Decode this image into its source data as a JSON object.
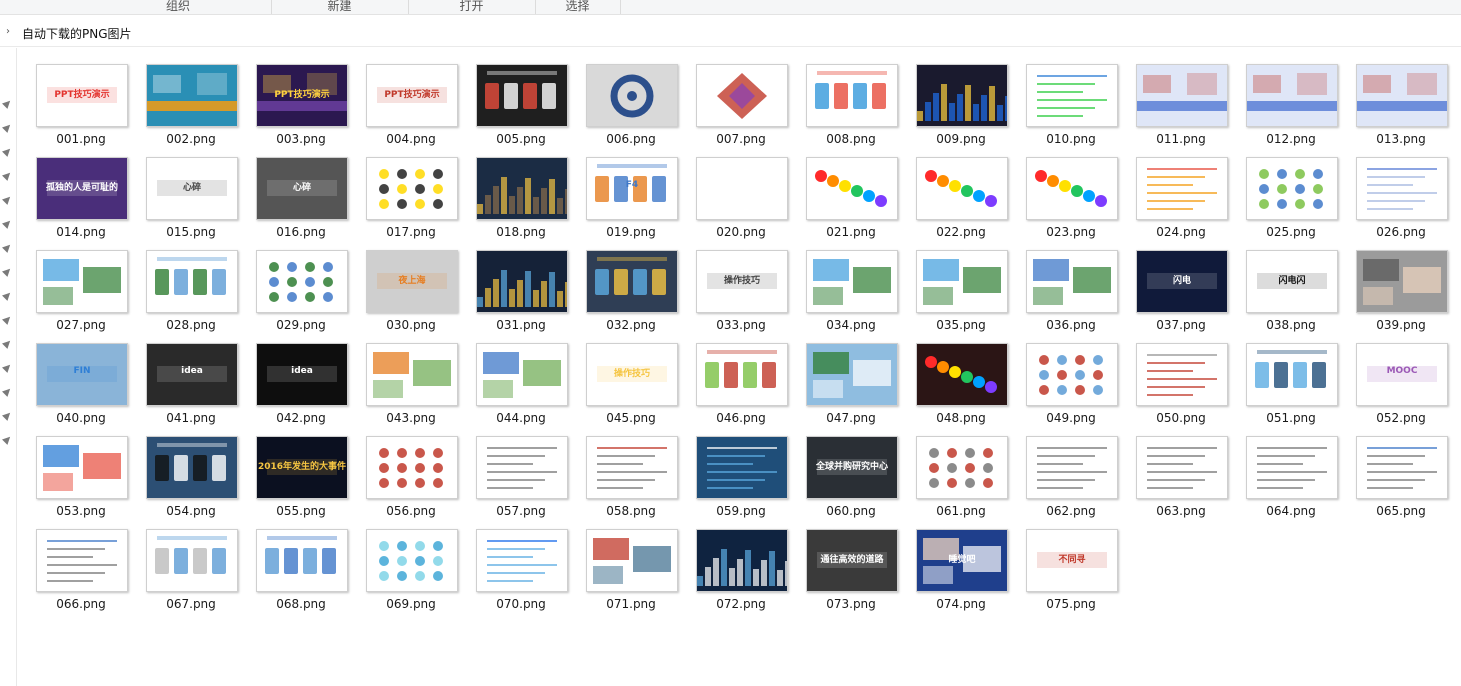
{
  "toolbar": {
    "groups": [
      "组织",
      "新建",
      "打开",
      "选择"
    ]
  },
  "address": {
    "path": "自动下载的PNG图片"
  },
  "files": [
    {
      "name": "001.png",
      "bg": "#ffffff",
      "fg": "#e3342f",
      "accent": "#2f7fd6",
      "motif": "text",
      "text": "PPT技巧演示"
    },
    {
      "name": "002.png",
      "bg": "#2a8fb5",
      "fg": "#ffffff",
      "accent": "#f39c12",
      "motif": "banner",
      "text": ""
    },
    {
      "name": "003.png",
      "bg": "#2b1850",
      "fg": "#ffd23f",
      "accent": "#6b3fa0",
      "motif": "banner",
      "text": "PPT技巧演示"
    },
    {
      "name": "004.png",
      "bg": "#ffffff",
      "fg": "#c0392b",
      "accent": "#2ecc40",
      "motif": "text",
      "text": "PPT技巧演示"
    },
    {
      "name": "005.png",
      "bg": "#1f1f1f",
      "fg": "#ffffff",
      "accent": "#e74c3c",
      "motif": "cards",
      "text": ""
    },
    {
      "name": "006.png",
      "bg": "#d9d9d9",
      "fg": "#2c4f8c",
      "accent": "#ffffff",
      "motif": "wheel",
      "text": ""
    },
    {
      "name": "007.png",
      "bg": "#ffffff",
      "fg": "#c0392b",
      "accent": "#8e44ad",
      "motif": "diamond",
      "text": ""
    },
    {
      "name": "008.png",
      "bg": "#ffffff",
      "fg": "#e74c3c",
      "accent": "#3498db",
      "motif": "cards",
      "text": ""
    },
    {
      "name": "009.png",
      "bg": "#1a1a2e",
      "fg": "#ffd23f",
      "accent": "#1f6feb",
      "motif": "city",
      "text": ""
    },
    {
      "name": "010.png",
      "bg": "#ffffff",
      "fg": "#2f7fd6",
      "accent": "#2ecc40",
      "motif": "lines",
      "text": ""
    },
    {
      "name": "011.png",
      "bg": "#dfe6f7",
      "fg": "#c0392b",
      "accent": "#5b7ed6",
      "motif": "banner",
      "text": ""
    },
    {
      "name": "012.png",
      "bg": "#dfe6f7",
      "fg": "#c0392b",
      "accent": "#5b7ed6",
      "motif": "banner",
      "text": ""
    },
    {
      "name": "013.png",
      "bg": "#dfe6f7",
      "fg": "#c0392b",
      "accent": "#5b7ed6",
      "motif": "banner",
      "text": ""
    },
    {
      "name": "014.png",
      "bg": "#4a2e7a",
      "fg": "#ffffff",
      "accent": "#b58bff",
      "motif": "text",
      "text": "孤独的人是可耻的"
    },
    {
      "name": "015.png",
      "bg": "#ffffff",
      "fg": "#444444",
      "accent": "#c0392b",
      "motif": "text",
      "text": "心碎"
    },
    {
      "name": "016.png",
      "bg": "#555555",
      "fg": "#ffffff",
      "accent": "#555555",
      "motif": "text",
      "text": "心碎"
    },
    {
      "name": "017.png",
      "bg": "#ffffff",
      "fg": "#222222",
      "accent": "#ffd800",
      "motif": "dots",
      "text": ""
    },
    {
      "name": "018.png",
      "bg": "#1b2c44",
      "fg": "#f5c542",
      "accent": "#8a6e4b",
      "motif": "city",
      "text": ""
    },
    {
      "name": "019.png",
      "bg": "#ffffff",
      "fg": "#3f78c8",
      "accent": "#e67e22",
      "motif": "cards",
      "text": "F4"
    },
    {
      "name": "020.png",
      "bg": "#ffffff",
      "fg": "#ffffff",
      "accent": "#ffffff",
      "motif": "blank",
      "text": ""
    },
    {
      "name": "021.png",
      "bg": "#ffffff",
      "fg": "#ff2a2a",
      "accent": "#8e44ad",
      "motif": "rainbow",
      "text": ""
    },
    {
      "name": "022.png",
      "bg": "#ffffff",
      "fg": "#ff2a2a",
      "accent": "#00a2ff",
      "motif": "rainbow",
      "text": ""
    },
    {
      "name": "023.png",
      "bg": "#ffffff",
      "fg": "#ff2a2a",
      "accent": "#b400ff",
      "motif": "rainbow",
      "text": ""
    },
    {
      "name": "024.png",
      "bg": "#ffffff",
      "fg": "#e74c3c",
      "accent": "#f39c12",
      "motif": "lines",
      "text": ""
    },
    {
      "name": "025.png",
      "bg": "#ffffff",
      "fg": "#3f78c8",
      "accent": "#7ac143",
      "motif": "dots",
      "text": ""
    },
    {
      "name": "026.png",
      "bg": "#ffffff",
      "fg": "#5b7ed6",
      "accent": "#a5b8e0",
      "motif": "lines",
      "text": ""
    },
    {
      "name": "027.png",
      "bg": "#ffffff",
      "fg": "#2e7d32",
      "accent": "#4aa3df",
      "motif": "photos",
      "text": ""
    },
    {
      "name": "028.png",
      "bg": "#ffffff",
      "fg": "#5b9bd5",
      "accent": "#2e7d32",
      "motif": "cards",
      "text": ""
    },
    {
      "name": "029.png",
      "bg": "#ffffff",
      "fg": "#3f78c8",
      "accent": "#2e7d32",
      "motif": "dots",
      "text": ""
    },
    {
      "name": "030.png",
      "bg": "#cfcfcf",
      "fg": "#e67e22",
      "accent": "#ffffff",
      "motif": "text",
      "text": "夜上海"
    },
    {
      "name": "031.png",
      "bg": "#152238",
      "fg": "#5dade2",
      "accent": "#f5c542",
      "motif": "city",
      "text": ""
    },
    {
      "name": "032.png",
      "bg": "#2f3e55",
      "fg": "#f5c542",
      "accent": "#5dade2",
      "motif": "cards",
      "text": ""
    },
    {
      "name": "033.png",
      "bg": "#ffffff",
      "fg": "#444444",
      "accent": "#e67e22",
      "motif": "text",
      "text": "操作技巧"
    },
    {
      "name": "034.png",
      "bg": "#ffffff",
      "fg": "#2e7d32",
      "accent": "#4aa3df",
      "motif": "photos",
      "text": ""
    },
    {
      "name": "035.png",
      "bg": "#ffffff",
      "fg": "#2e7d32",
      "accent": "#4aa3df",
      "motif": "photos",
      "text": ""
    },
    {
      "name": "036.png",
      "bg": "#ffffff",
      "fg": "#2e7d32",
      "accent": "#3f78c8",
      "motif": "photos",
      "text": ""
    },
    {
      "name": "037.png",
      "bg": "#101a3a",
      "fg": "#ffffff",
      "accent": "#3f78c8",
      "motif": "text",
      "text": "闪电"
    },
    {
      "name": "038.png",
      "bg": "#ffffff",
      "fg": "#111111",
      "accent": "#3f78c8",
      "motif": "text",
      "text": "闪电闪"
    },
    {
      "name": "039.png",
      "bg": "#9b9b9b",
      "fg": "#f0d5c0",
      "accent": "#5a5a5a",
      "motif": "photos",
      "text": ""
    },
    {
      "name": "040.png",
      "bg": "#8ab4d8",
      "fg": "#2f7fd6",
      "accent": "#f0d5c0",
      "motif": "text",
      "text": "FIN"
    },
    {
      "name": "041.png",
      "bg": "#2a2a2a",
      "fg": "#ffffff",
      "accent": "#d0d0d0",
      "motif": "text",
      "text": "idea"
    },
    {
      "name": "042.png",
      "bg": "#0e0e0e",
      "fg": "#ffffff",
      "accent": "#d0d0d0",
      "motif": "text",
      "text": "idea"
    },
    {
      "name": "043.png",
      "bg": "#ffffff",
      "fg": "#6aa84f",
      "accent": "#e67e22",
      "motif": "photos",
      "text": ""
    },
    {
      "name": "044.png",
      "bg": "#ffffff",
      "fg": "#6aa84f",
      "accent": "#3f78c8",
      "motif": "photos",
      "text": ""
    },
    {
      "name": "045.png",
      "bg": "#ffffff",
      "fg": "#f5c542",
      "accent": "#1a1a1a",
      "motif": "text",
      "text": "操作技巧"
    },
    {
      "name": "046.png",
      "bg": "#ffffff",
      "fg": "#c0392b",
      "accent": "#7ac143",
      "motif": "cards",
      "text": ""
    },
    {
      "name": "047.png",
      "bg": "#8fbde0",
      "fg": "#ffffff",
      "accent": "#2e7d32",
      "motif": "photos",
      "text": ""
    },
    {
      "name": "048.png",
      "bg": "#2b1515",
      "fg": "#ff6a00",
      "accent": "#7d3cff",
      "motif": "rainbow",
      "text": ""
    },
    {
      "name": "049.png",
      "bg": "#ffffff",
      "fg": "#5b9bd5",
      "accent": "#c0392b",
      "motif": "dots",
      "text": ""
    },
    {
      "name": "050.png",
      "bg": "#ffffff",
      "fg": "#999999",
      "accent": "#c0392b",
      "motif": "lines",
      "text": ""
    },
    {
      "name": "051.png",
      "bg": "#ffffff",
      "fg": "#1f4e79",
      "accent": "#5dade2",
      "motif": "cards",
      "text": ""
    },
    {
      "name": "052.png",
      "bg": "#ffffff",
      "fg": "#9b59b6",
      "accent": "#5dade2",
      "motif": "text",
      "text": "MOOC"
    },
    {
      "name": "053.png",
      "bg": "#ffffff",
      "fg": "#e74c3c",
      "accent": "#2f7fd6",
      "motif": "photos",
      "text": ""
    },
    {
      "name": "054.png",
      "bg": "#2c4f74",
      "fg": "#ffffff",
      "accent": "#111111",
      "motif": "cards",
      "text": ""
    },
    {
      "name": "055.png",
      "bg": "#0b1020",
      "fg": "#f5c542",
      "accent": "#0b1020",
      "motif": "text",
      "text": "2016年发生的大事件"
    },
    {
      "name": "056.png",
      "bg": "#ffffff",
      "fg": "#c0392b",
      "accent": "#c0392b",
      "motif": "dots",
      "text": ""
    },
    {
      "name": "057.png",
      "bg": "#ffffff",
      "fg": "#777777",
      "accent": "#777777",
      "motif": "lines",
      "text": ""
    },
    {
      "name": "058.png",
      "bg": "#ffffff",
      "fg": "#c0392b",
      "accent": "#777777",
      "motif": "lines",
      "text": ""
    },
    {
      "name": "059.png",
      "bg": "#1f4e79",
      "fg": "#ffffff",
      "accent": "#5dade2",
      "motif": "lines",
      "text": ""
    },
    {
      "name": "060.png",
      "bg": "#2a2f35",
      "fg": "#ffffff",
      "accent": "#666666",
      "motif": "text",
      "text": "全球并购研究中心"
    },
    {
      "name": "061.png",
      "bg": "#ffffff",
      "fg": "#c0392b",
      "accent": "#777777",
      "motif": "dots",
      "text": ""
    },
    {
      "name": "062.png",
      "bg": "#ffffff",
      "fg": "#777777",
      "accent": "#777777",
      "motif": "lines",
      "text": ""
    },
    {
      "name": "063.png",
      "bg": "#ffffff",
      "fg": "#777777",
      "accent": "#777777",
      "motif": "lines",
      "text": ""
    },
    {
      "name": "064.png",
      "bg": "#ffffff",
      "fg": "#777777",
      "accent": "#777777",
      "motif": "lines",
      "text": ""
    },
    {
      "name": "065.png",
      "bg": "#ffffff",
      "fg": "#3f78c8",
      "accent": "#777777",
      "motif": "lines",
      "text": ""
    },
    {
      "name": "066.png",
      "bg": "#ffffff",
      "fg": "#3f78c8",
      "accent": "#777777",
      "motif": "lines",
      "text": ""
    },
    {
      "name": "067.png",
      "bg": "#ffffff",
      "fg": "#5b9bd5",
      "accent": "#bbbbbb",
      "motif": "cards",
      "text": ""
    },
    {
      "name": "068.png",
      "bg": "#ffffff",
      "fg": "#3f78c8",
      "accent": "#5b9bd5",
      "motif": "cards",
      "text": ""
    },
    {
      "name": "069.png",
      "bg": "#ffffff",
      "fg": "#3fa7d6",
      "accent": "#7fd3e6",
      "motif": "dots",
      "text": ""
    },
    {
      "name": "070.png",
      "bg": "#ffffff",
      "fg": "#1f6feb",
      "accent": "#5dade2",
      "motif": "lines",
      "text": ""
    },
    {
      "name": "071.png",
      "bg": "#ffffff",
      "fg": "#3a6b8c",
      "accent": "#c0392b",
      "motif": "photos",
      "text": ""
    },
    {
      "name": "072.png",
      "bg": "#0f2340",
      "fg": "#5dade2",
      "accent": "#ffffff",
      "motif": "city",
      "text": ""
    },
    {
      "name": "073.png",
      "bg": "#3a3a3a",
      "fg": "#ffffff",
      "accent": "#f5c542",
      "motif": "text",
      "text": "通往高效的道路"
    },
    {
      "name": "074.png",
      "bg": "#1f3f8c",
      "fg": "#ffffff",
      "accent": "#f0d5c0",
      "motif": "photos",
      "text": "睡觉吧"
    },
    {
      "name": "075.png",
      "bg": "#ffffff",
      "fg": "#c0392b",
      "accent": "#444444",
      "motif": "text",
      "text": "不同寻"
    }
  ]
}
